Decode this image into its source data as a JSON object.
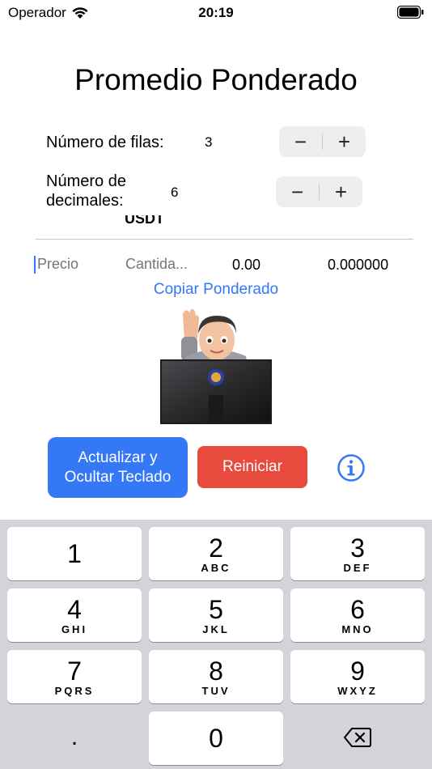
{
  "status_bar": {
    "carrier": "Operador",
    "time": "20:19"
  },
  "title": "Promedio Ponderado",
  "rows_setting": {
    "label": "Número de filas:",
    "value": "3",
    "minus": "−",
    "plus": "+"
  },
  "decimals_setting": {
    "label_line1": "Número de",
    "label_line2": "decimales:",
    "value": "6",
    "minus": "−",
    "plus": "+"
  },
  "table": {
    "partial_header": "USDT",
    "price_placeholder": "Precio",
    "quantity_placeholder": "Cantida...",
    "total": "0.00",
    "weighted": "0.000000"
  },
  "copy_link": "Copiar Ponderado",
  "buttons": {
    "update_line1": "Actualizar y",
    "update_line2": "Ocultar Teclado",
    "reset": "Reiniciar"
  },
  "colors": {
    "accent": "#3478f6",
    "danger": "#e84b3d",
    "keyboard_bg": "#d2d4da"
  },
  "keyboard": {
    "keys": [
      {
        "num": "1",
        "letters": ""
      },
      {
        "num": "2",
        "letters": "ABC"
      },
      {
        "num": "3",
        "letters": "DEF"
      },
      {
        "num": "4",
        "letters": "GHI"
      },
      {
        "num": "5",
        "letters": "JKL"
      },
      {
        "num": "6",
        "letters": "MNO"
      },
      {
        "num": "7",
        "letters": "PQRS"
      },
      {
        "num": "8",
        "letters": "TUV"
      },
      {
        "num": "9",
        "letters": "WXYZ"
      }
    ],
    "decimal": ".",
    "zero": "0",
    "delete_icon": "backspace-icon"
  }
}
